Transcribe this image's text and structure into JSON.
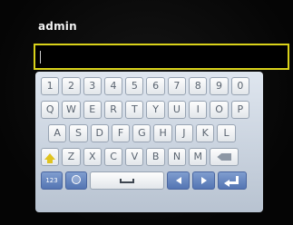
{
  "form": {
    "label": "admin",
    "input_value": ""
  },
  "keyboard": {
    "row_numbers": [
      "1",
      "2",
      "3",
      "4",
      "5",
      "6",
      "7",
      "8",
      "9",
      "0"
    ],
    "row_top": [
      "Q",
      "W",
      "E",
      "R",
      "T",
      "Y",
      "U",
      "I",
      "O",
      "P"
    ],
    "row_home": [
      "A",
      "S",
      "D",
      "F",
      "G",
      "H",
      "J",
      "K",
      "L"
    ],
    "row_bottom": [
      "Z",
      "X",
      "C",
      "V",
      "B",
      "N",
      "M"
    ],
    "symbol_key_label": "123",
    "icons": {
      "shift": "shift-icon",
      "backspace": "backspace-icon",
      "language": "globe-icon",
      "space": "space-icon",
      "left": "arrow-left-icon",
      "right": "arrow-right-icon",
      "enter": "enter-icon"
    }
  },
  "colors": {
    "input_border": "#d9d21a",
    "shift_arrow": "#e0c31f",
    "function_key": "#5f7fbd"
  }
}
